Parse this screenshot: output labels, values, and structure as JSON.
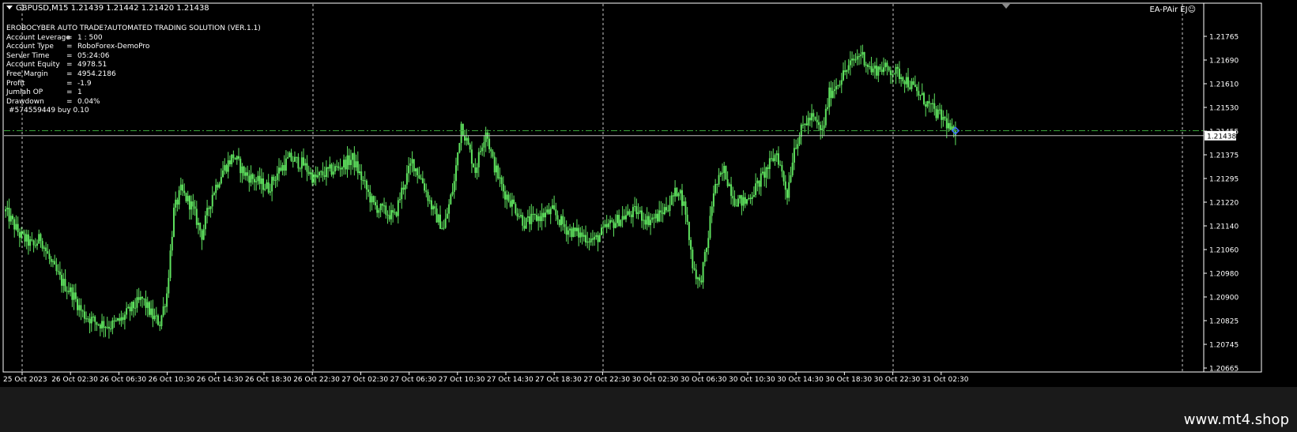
{
  "header": {
    "symbol_line": "GBPUSD,M15  1.21439 1.21442 1.21420 1.21438"
  },
  "ea_label": "EA-PAir EJ☺",
  "info_panel": {
    "title": "EROBOCYBER AUTO TRADE?AUTOMATED TRADING SOLUTION (VER.1.1)",
    "rows": [
      {
        "key": "Account Leverage",
        "value": "1 : 500"
      },
      {
        "key": "Account Type",
        "value": "RoboForex-DemoPro"
      },
      {
        "key": "Server Time",
        "value": "05:24:06"
      },
      {
        "key": "Account Equity",
        "value": "4978.51"
      },
      {
        "key": "Free Margin",
        "value": "4954.2186"
      },
      {
        "key": "Profit",
        "value": "-1.9"
      },
      {
        "key": "Jumlah OP",
        "value": "1"
      },
      {
        "key": "Drawdown",
        "value": "0.04%"
      }
    ],
    "order_line": "#574559449 buy 0.10"
  },
  "colors": {
    "background": "#000000",
    "candle": "#5fe35f",
    "axis": "#ffffff",
    "grid": "#c8c8c8",
    "order_line": "#3aa53a",
    "order_marker": "#3d6bff"
  },
  "chart_data": {
    "type": "candlestick",
    "symbol": "GBPUSD",
    "timeframe": "M15",
    "bid_price": 1.21438,
    "order_price": 1.21455,
    "ylim": [
      1.2064,
      1.2182
    ],
    "y_ticks": [
      "1.21765",
      "1.21690",
      "1.21610",
      "1.21530",
      "1.21455",
      "1.21375",
      "1.21295",
      "1.21220",
      "1.21140",
      "1.21060",
      "1.20980",
      "1.20900",
      "1.20825",
      "1.20745",
      "1.20665"
    ],
    "price_label": "1.21438",
    "x_ticks": [
      "25 Oct 2023",
      "26 Oct 02:30",
      "26 Oct 06:30",
      "26 Oct 10:30",
      "26 Oct 14:30",
      "26 Oct 18:30",
      "26 Oct 22:30",
      "27 Oct 02:30",
      "27 Oct 06:30",
      "27 Oct 10:30",
      "27 Oct 14:30",
      "27 Oct 18:30",
      "27 Oct 22:30",
      "30 Oct 02:30",
      "30 Oct 06:30",
      "30 Oct 10:30",
      "30 Oct 14:30",
      "30 Oct 18:30",
      "30 Oct 22:30",
      "31 Oct 02:30"
    ],
    "close_path": [
      [
        0,
        1.2118
      ],
      [
        8,
        1.211
      ],
      [
        16,
        1.2106
      ],
      [
        20,
        1.2109
      ],
      [
        26,
        1.21
      ],
      [
        32,
        1.2094
      ],
      [
        38,
        1.209
      ],
      [
        44,
        1.2083
      ],
      [
        52,
        1.208
      ],
      [
        60,
        1.2079
      ],
      [
        66,
        1.2081
      ],
      [
        72,
        1.2085
      ],
      [
        78,
        1.2088
      ],
      [
        84,
        1.2082
      ],
      [
        88,
        1.208
      ],
      [
        92,
        1.209
      ],
      [
        96,
        1.2118
      ],
      [
        100,
        1.2125
      ],
      [
        106,
        1.212
      ],
      [
        112,
        1.211
      ],
      [
        118,
        1.2124
      ],
      [
        124,
        1.2132
      ],
      [
        130,
        1.2137
      ],
      [
        136,
        1.2131
      ],
      [
        144,
        1.2128
      ],
      [
        150,
        1.2126
      ],
      [
        156,
        1.2132
      ],
      [
        162,
        1.2136
      ],
      [
        170,
        1.2134
      ],
      [
        176,
        1.2129
      ],
      [
        182,
        1.2131
      ],
      [
        190,
        1.2133
      ],
      [
        198,
        1.2136
      ],
      [
        204,
        1.2128
      ],
      [
        210,
        1.212
      ],
      [
        216,
        1.2118
      ],
      [
        222,
        1.2116
      ],
      [
        226,
        1.2125
      ],
      [
        232,
        1.2135
      ],
      [
        238,
        1.2128
      ],
      [
        244,
        1.2118
      ],
      [
        250,
        1.2112
      ],
      [
        256,
        1.2128
      ],
      [
        260,
        1.2148
      ],
      [
        264,
        1.214
      ],
      [
        268,
        1.2132
      ],
      [
        274,
        1.2146
      ],
      [
        278,
        1.2135
      ],
      [
        284,
        1.2125
      ],
      [
        290,
        1.212
      ],
      [
        296,
        1.2114
      ],
      [
        304,
        1.2116
      ],
      [
        312,
        1.2118
      ],
      [
        320,
        1.2112
      ],
      [
        328,
        1.211
      ],
      [
        336,
        1.2108
      ],
      [
        344,
        1.2113
      ],
      [
        352,
        1.2116
      ],
      [
        360,
        1.2118
      ],
      [
        366,
        1.2115
      ],
      [
        372,
        1.2116
      ],
      [
        378,
        1.212
      ],
      [
        384,
        1.2126
      ],
      [
        388,
        1.2118
      ],
      [
        392,
        1.21
      ],
      [
        396,
        1.2093
      ],
      [
        400,
        1.2105
      ],
      [
        404,
        1.2125
      ],
      [
        410,
        1.2132
      ],
      [
        416,
        1.2122
      ],
      [
        422,
        1.2121
      ],
      [
        428,
        1.2126
      ],
      [
        434,
        1.2132
      ],
      [
        440,
        1.2138
      ],
      [
        446,
        1.2124
      ],
      [
        450,
        1.214
      ],
      [
        456,
        1.2148
      ],
      [
        460,
        1.215
      ],
      [
        466,
        1.2145
      ],
      [
        470,
        1.2158
      ],
      [
        476,
        1.2163
      ],
      [
        482,
        1.2168
      ],
      [
        488,
        1.2172
      ],
      [
        494,
        1.2166
      ],
      [
        500,
        1.2167
      ],
      [
        506,
        1.2166
      ],
      [
        512,
        1.2164
      ],
      [
        518,
        1.216
      ],
      [
        524,
        1.2156
      ],
      [
        530,
        1.2152
      ],
      [
        536,
        1.2149
      ],
      [
        540,
        1.2145
      ],
      [
        542,
        1.21438
      ]
    ]
  },
  "brand_text": "www.mt4.shop"
}
